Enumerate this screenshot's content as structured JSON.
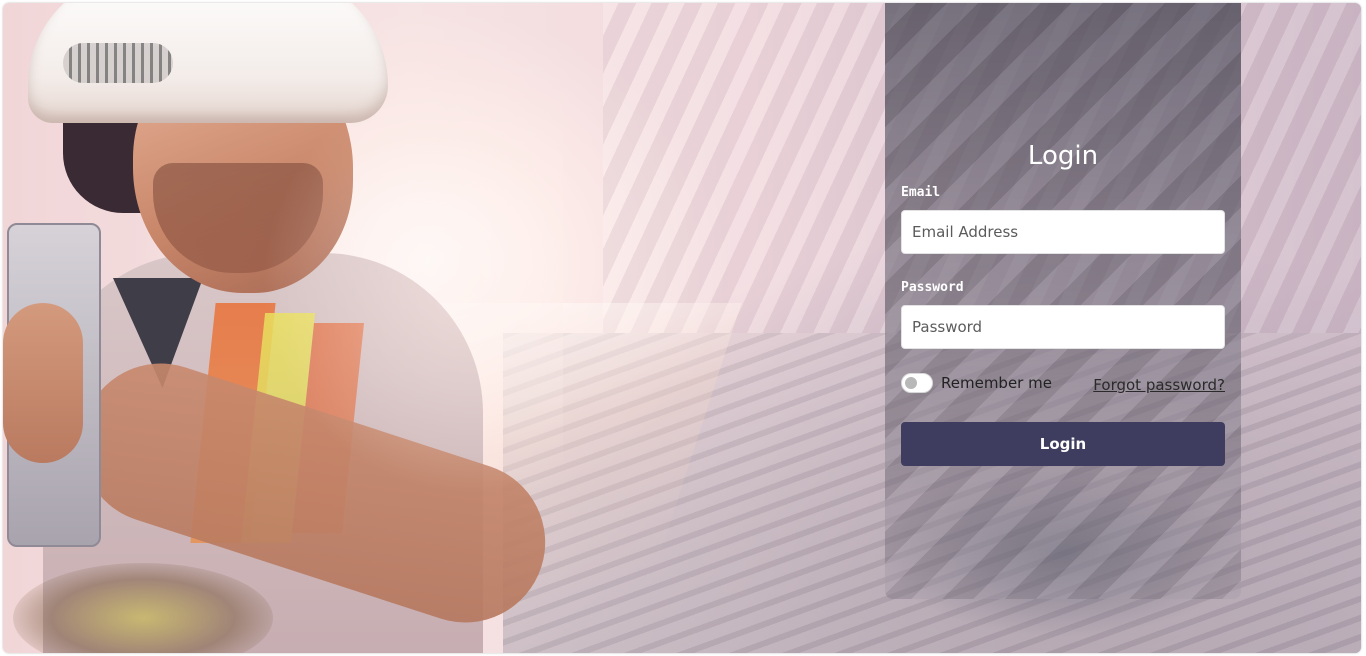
{
  "login": {
    "title": "Login",
    "email": {
      "label": "Email",
      "placeholder": "Email Address",
      "value": ""
    },
    "password": {
      "label": "Password",
      "placeholder": "Password",
      "value": ""
    },
    "remember_label": "Remember me",
    "remember_checked": false,
    "forgot_label": "Forgot password?",
    "submit_label": "Login"
  },
  "colors": {
    "button": "#3e3d5f",
    "panel": "#504e5c",
    "text_on_panel": "#ffffff"
  }
}
